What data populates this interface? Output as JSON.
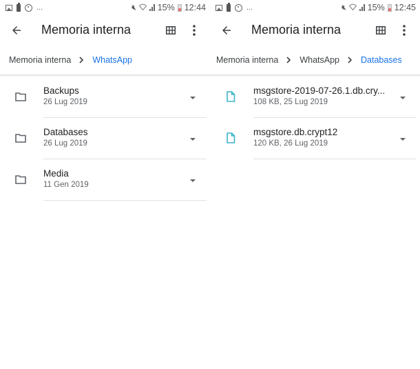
{
  "colors": {
    "accent": "#1a73e8",
    "file_icon": "#3bb4c8",
    "folder_icon": "#5f6368",
    "text_primary": "#202124",
    "text_secondary": "#5f6368"
  },
  "screens": [
    {
      "status_bar": {
        "left_icons": [
          "gallery-icon",
          "battery-saver-icon",
          "sync-icon",
          "more-notifications-icon"
        ],
        "overflow": "...",
        "battery_percent": "15%",
        "time": "12:44"
      },
      "app_bar": {
        "title": "Memoria interna",
        "back_icon": "arrow-left-icon",
        "view_icon": "grid-view-icon",
        "menu_icon": "more-vert-icon"
      },
      "breadcrumb": [
        {
          "label": "Memoria interna",
          "active": false
        },
        {
          "label": "WhatsApp",
          "active": true
        }
      ],
      "items": [
        {
          "type": "folder",
          "name": "Backups",
          "meta": "26 Lug 2019"
        },
        {
          "type": "folder",
          "name": "Databases",
          "meta": "26 Lug 2019"
        },
        {
          "type": "folder",
          "name": "Media",
          "meta": "11 Gen 2019"
        }
      ]
    },
    {
      "status_bar": {
        "left_icons": [
          "gallery-icon",
          "battery-saver-icon",
          "sync-icon",
          "more-notifications-icon"
        ],
        "overflow": "...",
        "battery_percent": "15%",
        "time": "12:45"
      },
      "app_bar": {
        "title": "Memoria interna",
        "back_icon": "arrow-left-icon",
        "view_icon": "grid-view-icon",
        "menu_icon": "more-vert-icon"
      },
      "breadcrumb": [
        {
          "label": "Memoria interna",
          "active": false
        },
        {
          "label": "WhatsApp",
          "active": false
        },
        {
          "label": "Databases",
          "active": true
        }
      ],
      "items": [
        {
          "type": "file",
          "name": "msgstore-2019-07-26.1.db.cry...",
          "meta": "108 KB, 25 Lug 2019"
        },
        {
          "type": "file",
          "name": "msgstore.db.crypt12",
          "meta": "120 KB, 26 Lug 2019"
        }
      ]
    }
  ]
}
